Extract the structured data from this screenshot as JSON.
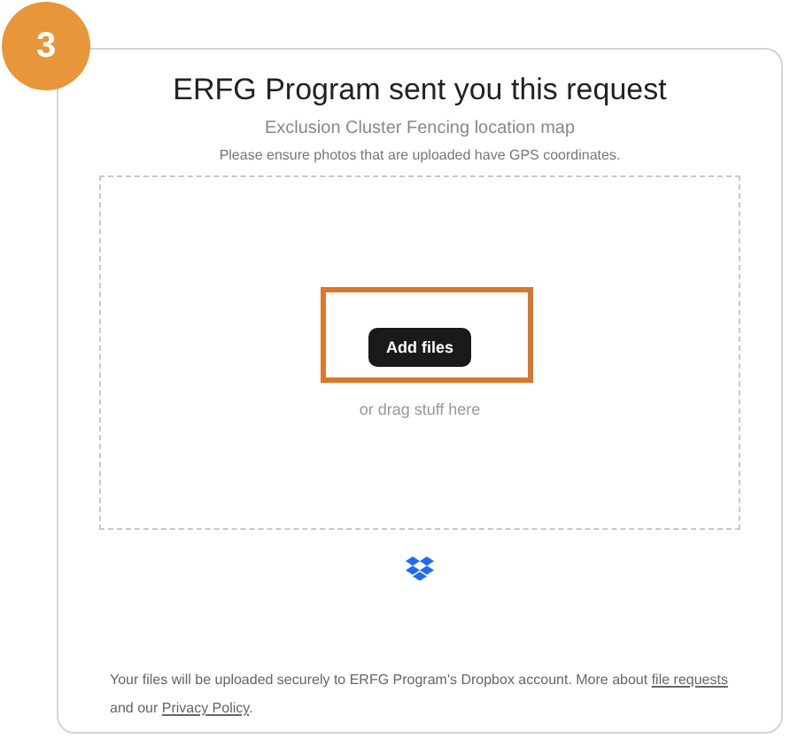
{
  "step_badge": "3",
  "title": "ERFG Program sent you this request",
  "subtitle": "Exclusion Cluster Fencing location map",
  "instructions": "Please ensure photos that are uploaded have GPS coordinates.",
  "drop_zone": {
    "button": "Add files",
    "hint": "or drag stuff here",
    "highlighted": true
  },
  "footer": [
    {
      "kind": "text",
      "text": "Your files will be uploaded securely to ERFG Program's Dropbox account. More about "
    },
    {
      "kind": "link",
      "text": "file requests"
    },
    {
      "kind": "text",
      "text": " and our "
    },
    {
      "kind": "link",
      "text": "Privacy Policy"
    },
    {
      "kind": "text",
      "text": "."
    }
  ]
}
